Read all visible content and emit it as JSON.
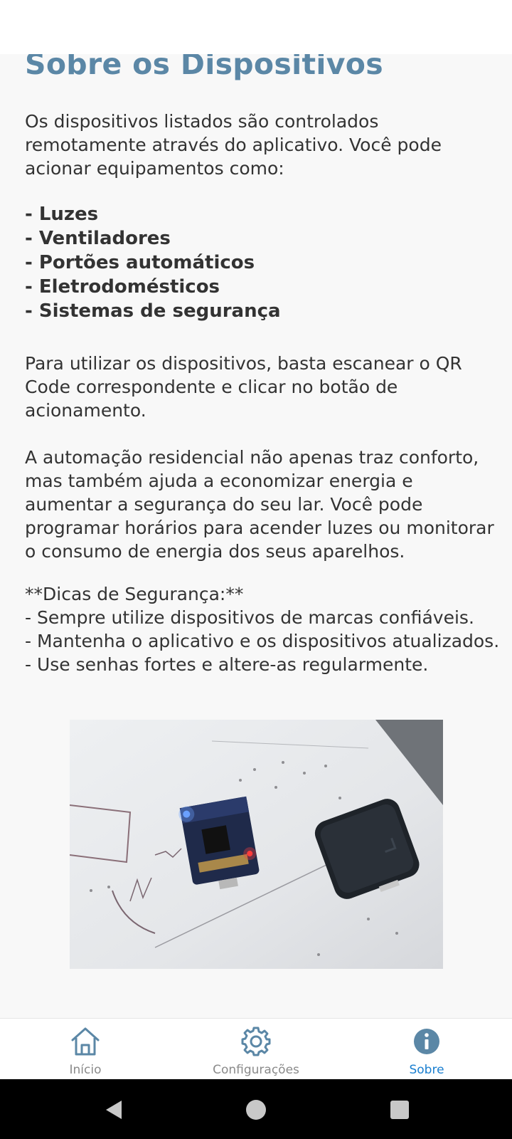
{
  "page": {
    "title": "Sobre os Dispositivos",
    "intro": "Os dispositivos listados são controlados remotamente através do aplicativo. Você pode acionar equipamentos como:",
    "devices": [
      "- Luzes",
      "- Ventiladores",
      "- Portões automáticos",
      "- Eletrodomésticos",
      "- Sistemas de segurança"
    ],
    "usage": "Para utilizar os dispositivos, basta escanear o QR Code correspondente e clicar no botão de acionamento.",
    "automation": "A automação residencial não apenas traz conforto, mas também ajuda a economizar energia e aumentar a segurança do seu lar. Você pode programar horários para acender luzes ou monitorar o consumo de energia dos seus aparelhos.",
    "tips": [
      "**Dicas de Segurança:**",
      "- Sempre utilize dispositivos de marcas confiáveis.",
      "- Mantenha o aplicativo e os dispositivos atualizados.",
      "- Use senhas fortes e altere-as regularmente."
    ]
  },
  "bottom_nav": {
    "items": [
      {
        "label": "Início",
        "icon": "home-icon",
        "active": false
      },
      {
        "label": "Configurações",
        "icon": "gear-icon",
        "active": false
      },
      {
        "label": "Sobre",
        "icon": "info-icon",
        "active": true
      }
    ]
  },
  "system_nav": {
    "buttons": [
      "back-icon",
      "home-circle-icon",
      "recents-icon"
    ]
  },
  "colors": {
    "title": "#5b87a6",
    "nav_icon": "#5b87a6",
    "nav_active_label": "#1a7fd0",
    "content_bg": "#f8f8f8"
  }
}
